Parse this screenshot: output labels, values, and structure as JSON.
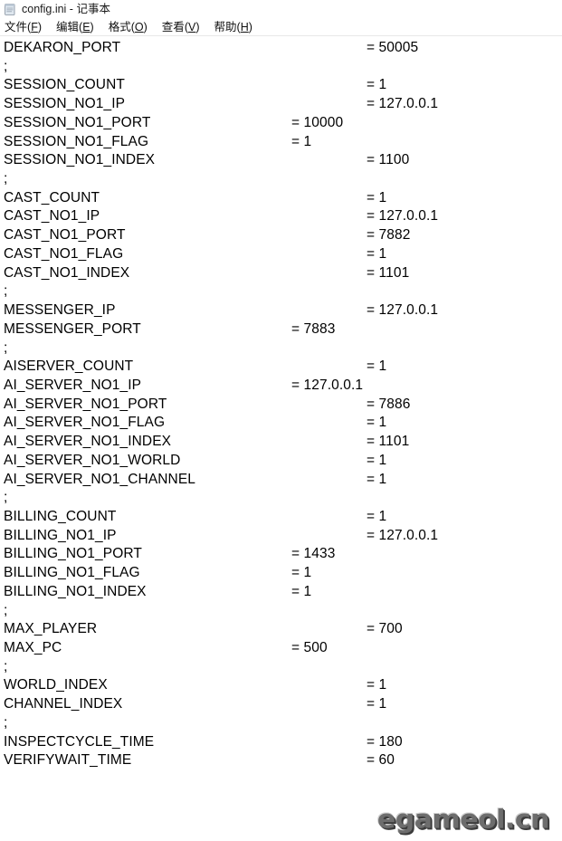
{
  "window": {
    "title": "config.ini - 记事本",
    "icon": "notepad-icon"
  },
  "menubar": {
    "items": [
      {
        "label": "文件",
        "accel": "F",
        "full": "文件(F)"
      },
      {
        "label": "编辑",
        "accel": "E",
        "full": "编辑(E)"
      },
      {
        "label": "格式",
        "accel": "O",
        "full": "格式(O)"
      },
      {
        "label": "查看",
        "accel": "V",
        "full": "查看(V)"
      },
      {
        "label": "帮助",
        "accel": "H",
        "full": "帮助(H)"
      }
    ]
  },
  "editor": {
    "filename": "config.ini",
    "lines": [
      {
        "key": "DEKARON_PORT",
        "value": "= 50005",
        "stop": 2
      },
      {
        "key": ";",
        "value": "",
        "stop": 0
      },
      {
        "key": "SESSION_COUNT",
        "value": "= 1",
        "stop": 2
      },
      {
        "key": "SESSION_NO1_IP",
        "value": "= 127.0.0.1",
        "stop": 2
      },
      {
        "key": "SESSION_NO1_PORT",
        "value": "= 10000",
        "stop": 1
      },
      {
        "key": "SESSION_NO1_FLAG",
        "value": "= 1",
        "stop": 1
      },
      {
        "key": "SESSION_NO1_INDEX",
        "value": "= 1100",
        "stop": 2
      },
      {
        "key": ";",
        "value": "",
        "stop": 0
      },
      {
        "key": "CAST_COUNT",
        "value": "= 1",
        "stop": 2
      },
      {
        "key": "CAST_NO1_IP",
        "value": "= 127.0.0.1",
        "stop": 2
      },
      {
        "key": "CAST_NO1_PORT",
        "value": "= 7882",
        "stop": 2
      },
      {
        "key": "CAST_NO1_FLAG",
        "value": "= 1",
        "stop": 2
      },
      {
        "key": "CAST_NO1_INDEX",
        "value": "= 1101",
        "stop": 2
      },
      {
        "key": ";",
        "value": "",
        "stop": 0
      },
      {
        "key": "MESSENGER_IP",
        "value": "= 127.0.0.1",
        "stop": 2
      },
      {
        "key": "MESSENGER_PORT",
        "value": "= 7883",
        "stop": 1
      },
      {
        "key": ";",
        "value": "",
        "stop": 0
      },
      {
        "key": "AISERVER_COUNT",
        "value": "= 1",
        "stop": 2
      },
      {
        "key": "AI_SERVER_NO1_IP",
        "value": "= 127.0.0.1",
        "stop": 1
      },
      {
        "key": "AI_SERVER_NO1_PORT",
        "value": "= 7886",
        "stop": 2
      },
      {
        "key": "AI_SERVER_NO1_FLAG",
        "value": "= 1",
        "stop": 2
      },
      {
        "key": "AI_SERVER_NO1_INDEX",
        "value": "= 1101",
        "stop": 2
      },
      {
        "key": "AI_SERVER_NO1_WORLD",
        "value": "= 1",
        "stop": 2
      },
      {
        "key": "AI_SERVER_NO1_CHANNEL",
        "value": "= 1",
        "stop": 2
      },
      {
        "key": ";",
        "value": "",
        "stop": 0
      },
      {
        "key": "BILLING_COUNT",
        "value": "= 1",
        "stop": 2
      },
      {
        "key": "BILLING_NO1_IP",
        "value": "= 127.0.0.1",
        "stop": 2
      },
      {
        "key": "BILLING_NO1_PORT",
        "value": "= 1433",
        "stop": 1
      },
      {
        "key": "BILLING_NO1_FLAG",
        "value": "= 1",
        "stop": 1
      },
      {
        "key": "BILLING_NO1_INDEX",
        "value": "= 1",
        "stop": 1
      },
      {
        "key": ";",
        "value": "",
        "stop": 0
      },
      {
        "key": "MAX_PLAYER",
        "value": "= 700",
        "stop": 2
      },
      {
        "key": "MAX_PC",
        "value": "= 500",
        "stop": 1
      },
      {
        "key": ";",
        "value": "",
        "stop": 0
      },
      {
        "key": "WORLD_INDEX",
        "value": "= 1",
        "stop": 2
      },
      {
        "key": "CHANNEL_INDEX",
        "value": "= 1",
        "stop": 2
      },
      {
        "key": ";",
        "value": "",
        "stop": 0
      },
      {
        "key": "INSPECTCYCLE_TIME",
        "value": "= 180",
        "stop": 2
      },
      {
        "key": "VERIFYWAIT_TIME",
        "value": "= 60",
        "stop": 2
      }
    ]
  },
  "watermark": {
    "text": "egameol.cn",
    "color": "#6d6d6d"
  }
}
